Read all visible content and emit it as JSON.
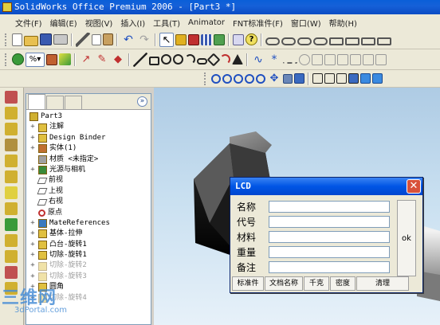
{
  "app": {
    "title": "SolidWorks Office Premium 2006 - [Part3 *]"
  },
  "menu": [
    "文件(F)",
    "编辑(E)",
    "视图(V)",
    "插入(I)",
    "工具(T)",
    "Animator",
    "FNT标准件(F)",
    "窗口(W)",
    "帮助(H)"
  ],
  "feature_tree": {
    "root": "Part3",
    "items": [
      {
        "label": "注解",
        "expander": "+",
        "icon": "annotations-icon",
        "dim": false
      },
      {
        "label": "Design Binder",
        "expander": "+",
        "icon": "design-binder-icon",
        "dim": false
      },
      {
        "label": "实体(1)",
        "expander": "+",
        "icon": "solid-bodies-icon",
        "dim": false
      },
      {
        "label": "材质 <未指定>",
        "expander": "",
        "icon": "material-icon",
        "dim": false
      },
      {
        "label": "光源与相机",
        "expander": "+",
        "icon": "lights-cameras-icon",
        "dim": false
      },
      {
        "label": "前视",
        "expander": "",
        "icon": "plane-icon",
        "dim": false
      },
      {
        "label": "上视",
        "expander": "",
        "icon": "plane-icon",
        "dim": false
      },
      {
        "label": "右视",
        "expander": "",
        "icon": "plane-icon",
        "dim": false
      },
      {
        "label": "原点",
        "expander": "",
        "icon": "origin-icon",
        "dim": false
      },
      {
        "label": "MateReferences",
        "expander": "+",
        "icon": "mate-references-icon",
        "dim": false
      },
      {
        "label": "基体-拉伸",
        "expander": "+",
        "icon": "extrude-icon",
        "dim": false
      },
      {
        "label": "凸台-旋转1",
        "expander": "+",
        "icon": "revolve-boss-icon",
        "dim": false
      },
      {
        "label": "切除-旋转1",
        "expander": "+",
        "icon": "revolve-cut-icon",
        "dim": false
      },
      {
        "label": "切除-旋转2",
        "expander": "+",
        "icon": "revolve-cut-icon",
        "dim": true
      },
      {
        "label": "切除-旋转3",
        "expander": "+",
        "icon": "revolve-cut-icon",
        "dim": true
      },
      {
        "label": "圆角",
        "expander": "+",
        "icon": "fillet-icon",
        "dim": false
      },
      {
        "label": "切除-旋转4",
        "expander": "+",
        "icon": "revolve-cut-icon",
        "dim": true
      }
    ]
  },
  "dialog": {
    "title": "LCD",
    "fields": [
      {
        "label": "名称",
        "value": ""
      },
      {
        "label": "代号",
        "value": ""
      },
      {
        "label": "材料",
        "value": ""
      },
      {
        "label": "重量",
        "value": ""
      },
      {
        "label": "备注",
        "value": ""
      }
    ],
    "ok_label": "ok",
    "buttons": [
      "标准件",
      "文档名称",
      "千克",
      "密度",
      "清理"
    ]
  },
  "watermark": {
    "text": "三维网",
    "url": "3dPortal.com"
  }
}
